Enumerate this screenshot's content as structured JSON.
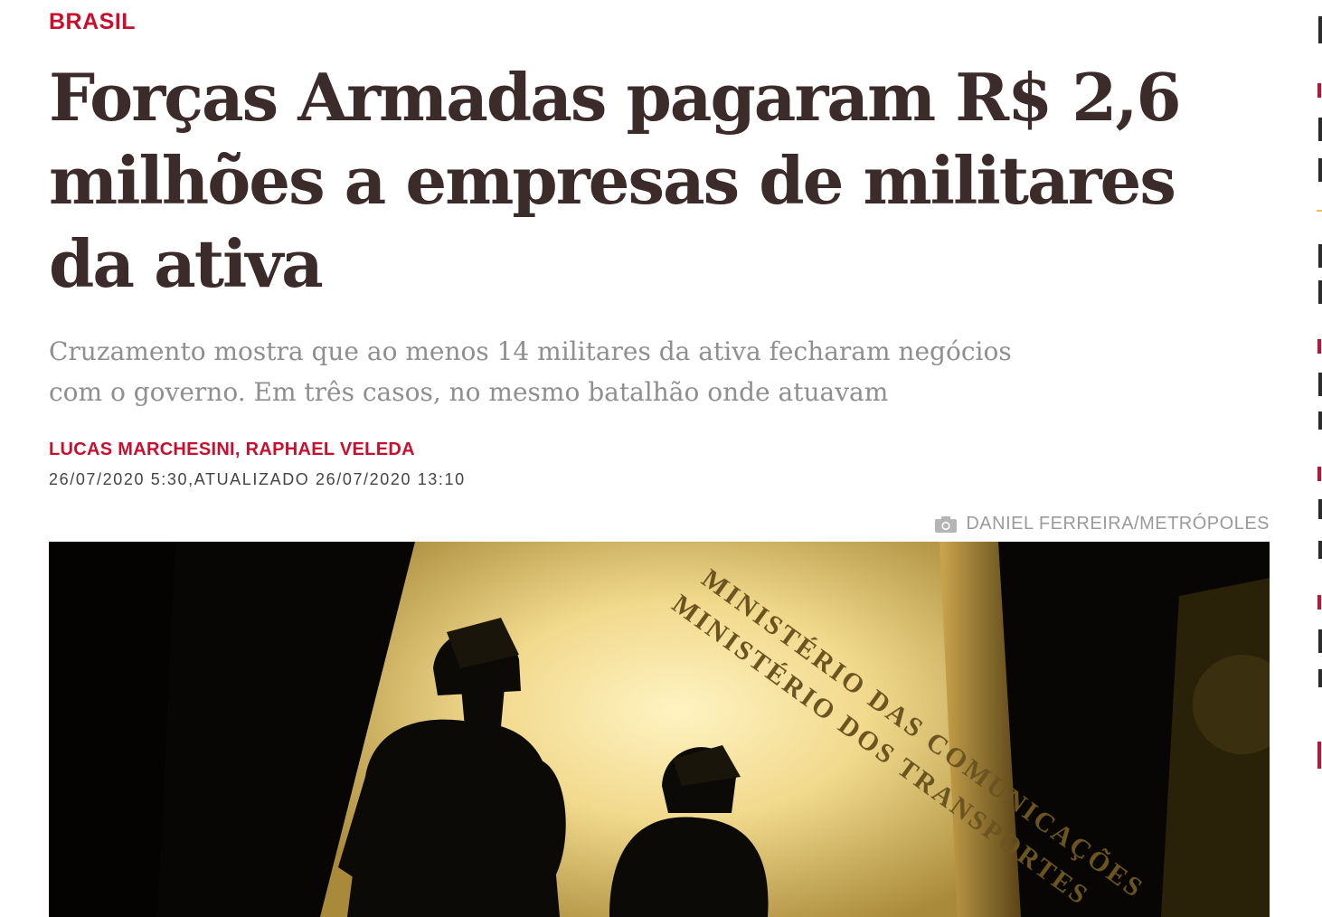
{
  "article": {
    "section": "BRASIL",
    "headline": "Forças Armadas pagaram R$ 2,6 milhões a empresas de militares da ativa",
    "subtitle": "Cruzamento mostra que ao menos 14 militares da ativa fecharam negócios com o governo. Em três casos, no mesmo batalhão onde atuavam",
    "authors": "LUCAS MARCHESINI, RAPHAEL VELEDA",
    "dates": "26/07/2020 5:30,ATUALIZADO 26/07/2020 13:10",
    "photo_credit": "DANIEL FERREIRA/METRÓPOLES",
    "photo_signage": [
      "MINISTÉRIO DAS COMUNICAÇÕES",
      "MINISTÉRIO DOS TRANSPORTES"
    ]
  },
  "icons": {
    "credit_icon": "camera-icon"
  },
  "colors": {
    "accent": "#c8102e",
    "headline": "#3b2b2b",
    "subtitle": "#8f8f8f",
    "meta": "#444444",
    "credit": "#9a9a9a"
  }
}
